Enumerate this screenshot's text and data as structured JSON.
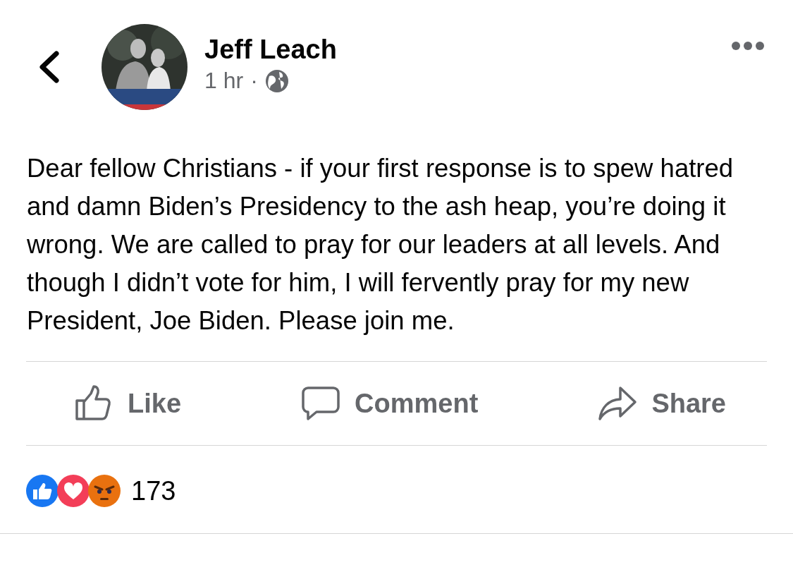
{
  "post": {
    "author": "Jeff Leach",
    "time": "1 hr",
    "separator": "·",
    "text": "Dear fellow Christians - if your first response is to spew hatred and damn Biden’s Presidency to the ash heap, you’re doing it wrong. We are called to pray for our leaders at all levels. And though I didn’t vote for him, I will fervently pray for my new President, Joe Biden. Please join me."
  },
  "actions": [
    {
      "kind": "like",
      "label": "Like"
    },
    {
      "kind": "comment",
      "label": "Comment"
    },
    {
      "kind": "share",
      "label": "Share"
    }
  ],
  "reactions": {
    "types": [
      {
        "kind": "like"
      },
      {
        "kind": "love"
      },
      {
        "kind": "angry"
      }
    ],
    "count": "173"
  }
}
